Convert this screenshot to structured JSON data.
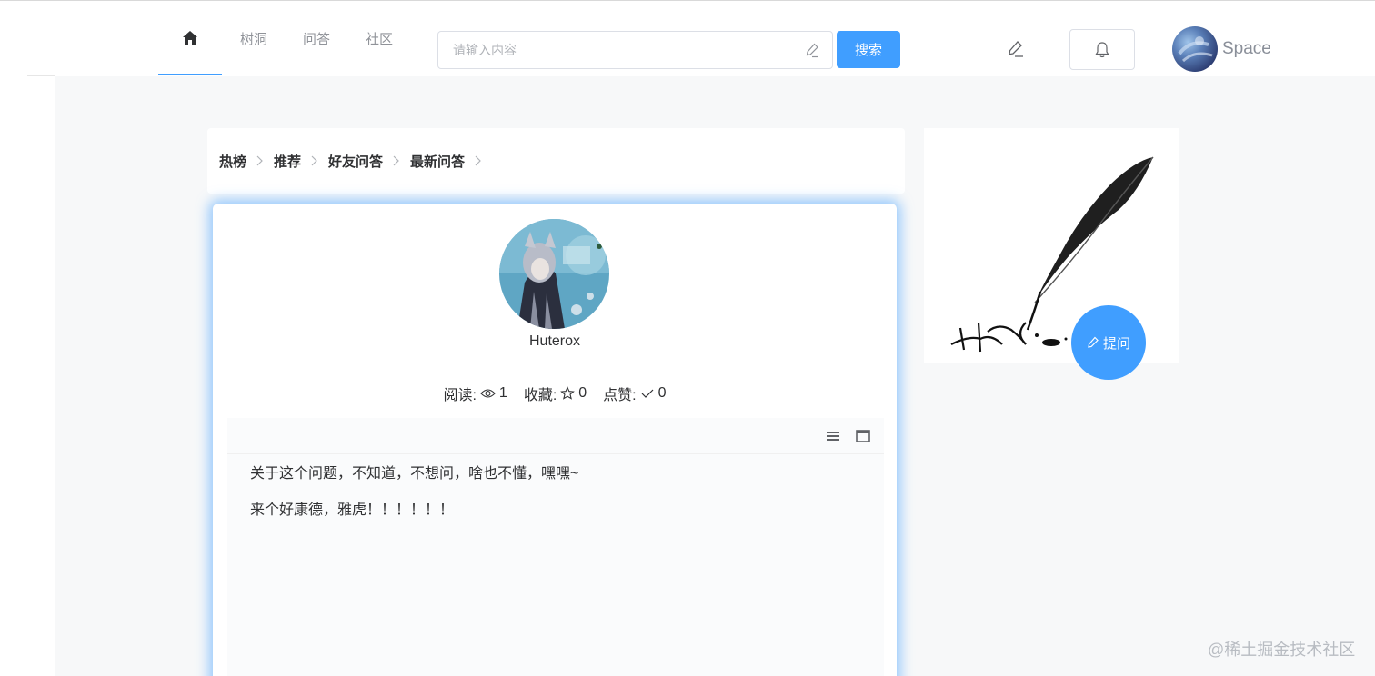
{
  "header": {
    "nav": {
      "home_icon": "home-icon",
      "items": [
        "树洞",
        "问答",
        "社区"
      ]
    },
    "search": {
      "placeholder": "请输入内容",
      "button_label": "搜索"
    },
    "user": {
      "name": "Space"
    }
  },
  "breadcrumb": [
    "热榜",
    "推荐",
    "好友问答",
    "最新问答"
  ],
  "question": {
    "author": "Huterox",
    "stats": {
      "read_label": "阅读:",
      "read_count": "1",
      "favorite_label": "收藏:",
      "favorite_count": "0",
      "like_label": "点赞:",
      "like_count": "0"
    },
    "content": [
      "关于这个问题，不知道，不想问，啥也不懂，嘿嘿~",
      "来个好康德，雅虎！！！！！！"
    ]
  },
  "sidebar": {
    "ask_button_label": "提问"
  },
  "watermark": "@稀土掘金技术社区",
  "colors": {
    "accent": "#409eff",
    "background": "#f7f8f9",
    "text": "#303133",
    "muted": "#909399"
  }
}
